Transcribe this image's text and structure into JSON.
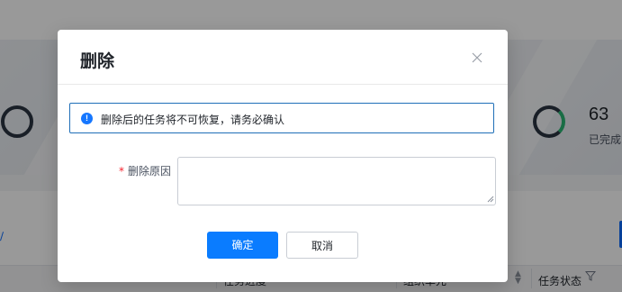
{
  "background": {
    "stats": [
      {
        "value": "63",
        "label": "已完成"
      }
    ],
    "table_columns": [
      {
        "label": "任务进度"
      },
      {
        "label": "组织单元"
      },
      {
        "label": "任务状态"
      }
    ]
  },
  "dialog": {
    "title": "删除",
    "close_icon": "close-icon",
    "alert": {
      "icon_text": "!",
      "message": "删除后的任务将不可恢复，请务必确认"
    },
    "form": {
      "required_mark": "*",
      "reason_label": "删除原因",
      "reason_value": "",
      "reason_placeholder": ""
    },
    "buttons": {
      "confirm": "确定",
      "cancel": "取消"
    }
  },
  "colors": {
    "primary": "#0a7cff",
    "alert_border": "#1f6fb8",
    "required": "#f5222d",
    "overlay": "rgba(0,0,0,0.40)"
  }
}
